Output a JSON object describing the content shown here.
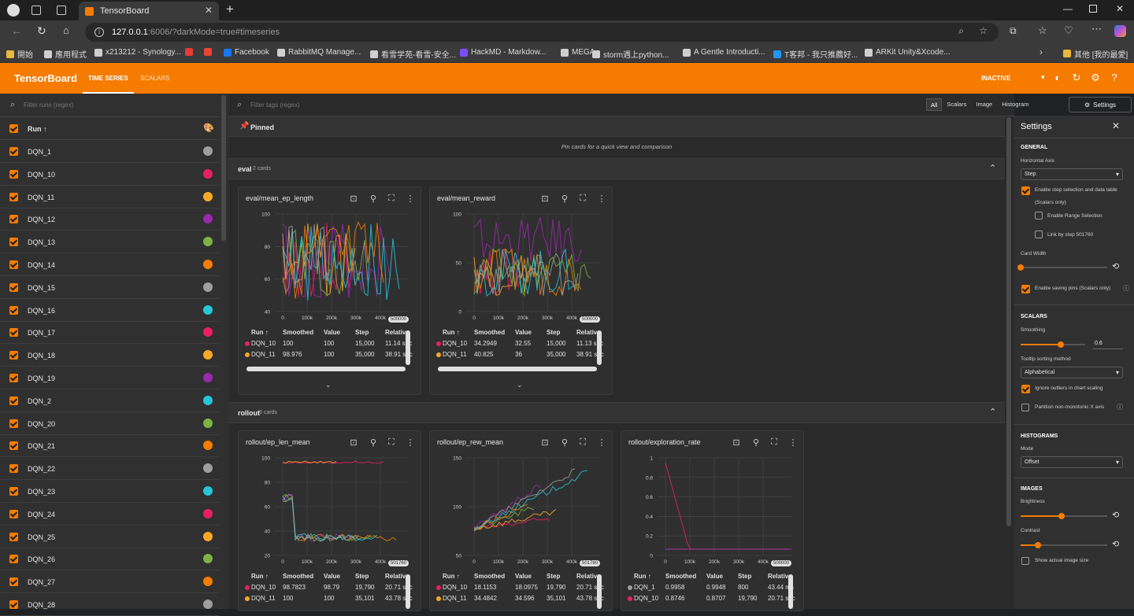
{
  "browser": {
    "tab_title": "TensorBoard",
    "url_host": "127.0.0.1",
    "url_rest": ":6006/?darkMode=true#timeseries",
    "bookmarks": [
      "開始",
      "應用程式",
      "x213212 - Synology...",
      "",
      "",
      "Facebook",
      "RabbitMQ Manage...",
      "看雪学苑-看雪-安全...",
      "HackMD - Markdow...",
      "MEGA",
      "storm遇上python...",
      "A Gentle Introducti...",
      "T客邦 - 我只推薦好...",
      "ARKit Unity&Xcode..."
    ],
    "other_bookmarks": "其他 [我的最愛]"
  },
  "header": {
    "brand": "TensorBoard",
    "tabs": [
      "TIME SERIES",
      "SCALARS"
    ],
    "status": "INACTIVE",
    "accent": "#f57c00"
  },
  "sidebar": {
    "filter_placeholder": "Filter runs (regex)",
    "column_header": "Run ↑",
    "runs": [
      {
        "name": "DQN_1",
        "color": "#9e9e9e"
      },
      {
        "name": "DQN_10",
        "color": "#e91e63"
      },
      {
        "name": "DQN_11",
        "color": "#f9a825"
      },
      {
        "name": "DQN_12",
        "color": "#9c27b0"
      },
      {
        "name": "DQN_13",
        "color": "#7cb342"
      },
      {
        "name": "DQN_14",
        "color": "#f57c00"
      },
      {
        "name": "DQN_15",
        "color": "#9e9e9e"
      },
      {
        "name": "DQN_16",
        "color": "#26c6da"
      },
      {
        "name": "DQN_17",
        "color": "#e91e63"
      },
      {
        "name": "DQN_18",
        "color": "#f9a825"
      },
      {
        "name": "DQN_19",
        "color": "#9c27b0"
      },
      {
        "name": "DQN_2",
        "color": "#26c6da"
      },
      {
        "name": "DQN_20",
        "color": "#7cb342"
      },
      {
        "name": "DQN_21",
        "color": "#f57c00"
      },
      {
        "name": "DQN_22",
        "color": "#9e9e9e"
      },
      {
        "name": "DQN_23",
        "color": "#26c6da"
      },
      {
        "name": "DQN_24",
        "color": "#e91e63"
      },
      {
        "name": "DQN_25",
        "color": "#f9a825"
      },
      {
        "name": "DQN_26",
        "color": "#7cb342"
      },
      {
        "name": "DQN_27",
        "color": "#f57c00"
      },
      {
        "name": "DQN_28",
        "color": "#9e9e9e"
      }
    ]
  },
  "main": {
    "filter_placeholder": "Filter tags (regex)",
    "type_tabs": [
      "All",
      "Scalars",
      "Image",
      "Histogram"
    ],
    "settings_button": "Settings",
    "pinned_label": "Pinned",
    "pinned_hint": "Pin cards for a quick view and comparison",
    "sections": [
      {
        "name": "eval",
        "count": "2 cards"
      },
      {
        "name": "rollout",
        "count": "3 cards"
      }
    ]
  },
  "cards": [
    {
      "title": "eval/mean_ep_length",
      "yticks": [
        "100",
        "80",
        "60",
        "40"
      ],
      "xticks": [
        "0",
        "100k",
        "200k",
        "300k",
        "400k"
      ],
      "chip": "500000",
      "rows": [
        [
          "DQN_10",
          "100",
          "100",
          "15,000",
          "11.14 sec"
        ],
        [
          "DQN_11",
          "98.976",
          "100",
          "35,000",
          "38.91 sec"
        ]
      ]
    },
    {
      "title": "eval/mean_reward",
      "yticks": [
        "100",
        "50",
        "0"
      ],
      "xticks": [
        "0",
        "100k",
        "200k",
        "300k",
        "400k"
      ],
      "chip": "500000",
      "rows": [
        [
          "DQN_10",
          "34.2949",
          "32.55",
          "15,000",
          "11.13 sec"
        ],
        [
          "DQN_11",
          "40.825",
          "36",
          "35,000",
          "38.91 sec"
        ]
      ]
    },
    {
      "title": "rollout/ep_len_mean",
      "yticks": [
        "100",
        "80",
        "60",
        "40",
        "20"
      ],
      "xticks": [
        "0",
        "100k",
        "200k",
        "300k",
        "400k"
      ],
      "chip": "501760",
      "rows": [
        [
          "DQN_10",
          "98.7823",
          "98.79",
          "19,790",
          "20.71 sec"
        ],
        [
          "DQN_11",
          "100",
          "100",
          "35,101",
          "43.78 sec"
        ]
      ]
    },
    {
      "title": "rollout/ep_rew_mean",
      "yticks": [
        "150",
        "100",
        "50"
      ],
      "xticks": [
        "0",
        "100k",
        "200k",
        "300k",
        "400k"
      ],
      "chip": "501760",
      "rows": [
        [
          "DQN_10",
          "18.1153",
          "18.0975",
          "19,790",
          "20.71 sec"
        ],
        [
          "DQN_11",
          "34.4842",
          "34.596",
          "35,101",
          "43.78 sec"
        ]
      ]
    },
    {
      "title": "rollout/exploration_rate",
      "yticks": [
        "1",
        "0.8",
        "0.6",
        "0.4",
        "0.2",
        "0"
      ],
      "xticks": [
        "0",
        "100k",
        "200k",
        "300k",
        "400k"
      ],
      "chip": "500000",
      "rows": [
        [
          "DQN_1",
          "0.9958",
          "0.9948",
          "800",
          "43.44 ms"
        ],
        [
          "DQN_10",
          "0.8746",
          "0.8707",
          "19,790",
          "20.71 sec"
        ]
      ]
    }
  ],
  "table_headers": [
    "Run ↑",
    "Smoothed",
    "Value",
    "Step",
    "Relative"
  ],
  "settings": {
    "title": "Settings",
    "general": "GENERAL",
    "horizontal_axis_label": "Horizontal Axis",
    "horizontal_axis_value": "Step",
    "enable_step_selection": "Enable step selection and data table",
    "scalars_only": "(Scalars only)",
    "enable_range": "Enable Range Selection",
    "link_by_step": "Link by step 501760",
    "card_width": "Card Width",
    "enable_saving_pins": "Enable saving pins (Scalars only)",
    "scalars": "SCALARS",
    "smoothing_label": "Smoothing",
    "smoothing_value": "0.6",
    "tooltip_sorting": "Tooltip sorting method",
    "tooltip_value": "Alphabetical",
    "ignore_outliers": "Ignore outliers in chart scaling",
    "partition": "Partition non-monotonic X axis",
    "histograms": "HISTOGRAMS",
    "mode_label": "Mode",
    "mode_value": "Offset",
    "images": "IMAGES",
    "brightness": "Brightness",
    "contrast": "Contrast",
    "show_actual": "Show actual image size"
  }
}
